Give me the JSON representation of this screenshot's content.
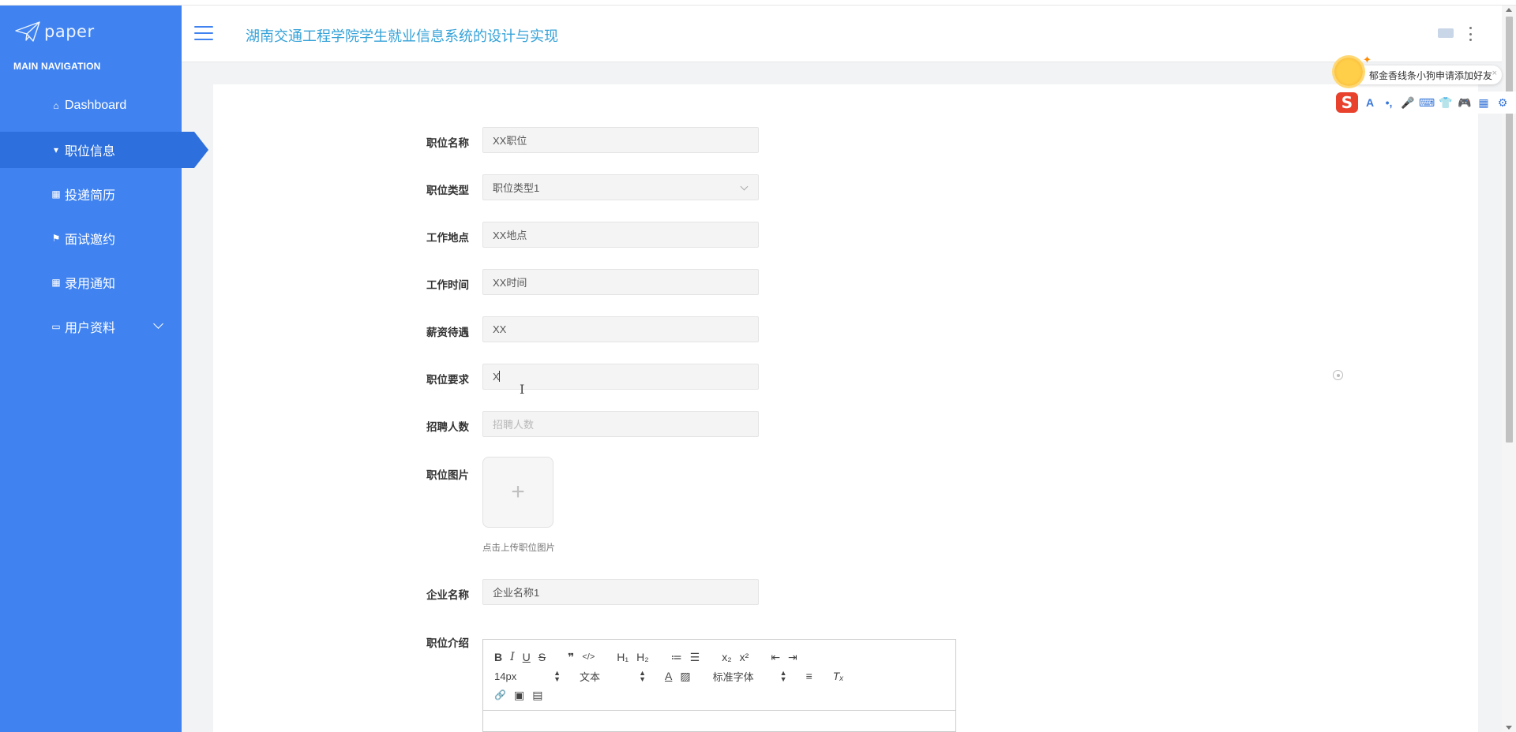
{
  "sidebar": {
    "logo_text": "paper",
    "nav_header": "MAIN NAVIGATION",
    "items": [
      {
        "label": "Dashboard",
        "icon": "home-icon",
        "glyph": "⌂"
      },
      {
        "label": "职位信息",
        "icon": "pin-icon",
        "glyph": "▾"
      },
      {
        "label": "投递简历",
        "icon": "grid-icon",
        "glyph": "▦"
      },
      {
        "label": "面试邀约",
        "icon": "flag-icon",
        "glyph": "⚑"
      },
      {
        "label": "录用通知",
        "icon": "grid-icon",
        "glyph": "▦"
      },
      {
        "label": "用户资料",
        "icon": "card-icon",
        "glyph": "▭"
      }
    ],
    "active_index": 1
  },
  "header": {
    "title": "湖南交通工程学院学生就业信息系统的设计与实现"
  },
  "form": {
    "fields": [
      {
        "label": "职位名称",
        "value": "XX职位",
        "placeholder": ""
      },
      {
        "label": "职位类型",
        "value": "职位类型1",
        "placeholder": ""
      },
      {
        "label": "工作地点",
        "value": "XX地点",
        "placeholder": ""
      },
      {
        "label": "工作时间",
        "value": "XX时间",
        "placeholder": ""
      },
      {
        "label": "薪资待遇",
        "value": "XX",
        "placeholder": ""
      },
      {
        "label": "职位要求",
        "value": "X",
        "placeholder": ""
      },
      {
        "label": "招聘人数",
        "value": "",
        "placeholder": "招聘人数"
      }
    ],
    "image_label": "职位图片",
    "upload_plus": "+",
    "upload_hint": "点击上传职位图片",
    "company_label": "企业名称",
    "company_value": "企业名称1",
    "intro_label": "职位介绍"
  },
  "editor": {
    "row1": [
      "B",
      "I",
      "U",
      "S",
      "❞",
      "</>",
      "H₁",
      "H₂",
      "≔",
      "☰",
      "x₂",
      "x²",
      "⇤",
      "⇥"
    ],
    "font_size": "14px",
    "text_style": "文本",
    "font_family": "标准字体",
    "row2_icons": [
      "A",
      "▨",
      "≡",
      "Tₓ"
    ],
    "row3": [
      "🔗",
      "▣",
      "▤"
    ]
  },
  "ime": {
    "message": "郁金香线条小狗申请添加好友",
    "close": "×",
    "logo": "S",
    "tools": [
      "A",
      "•,",
      "🎤",
      "⌨",
      "👕",
      "🎮",
      "▦",
      "⚙"
    ],
    "sparkle": "✦"
  },
  "colors": {
    "sidebar": "#4083f0",
    "sidebar_active": "#2d6fdc",
    "title": "#35a2d8"
  }
}
